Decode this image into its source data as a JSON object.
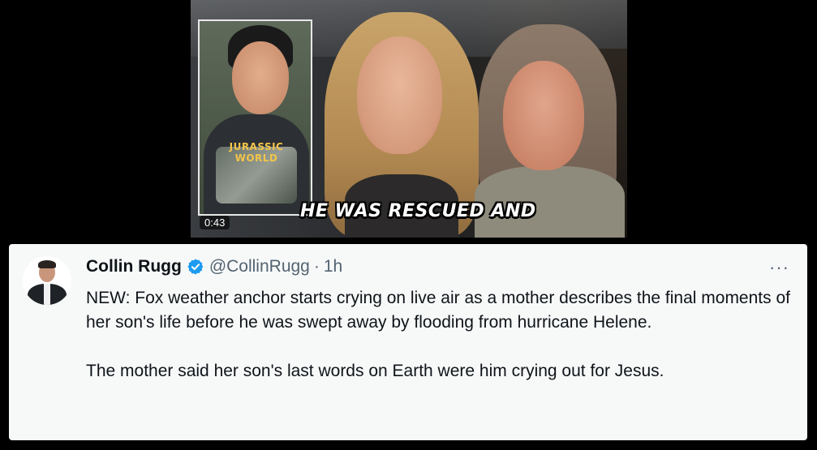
{
  "video": {
    "caption": "HE WAS RESCUED AND",
    "timestamp": "0:43",
    "inset_shirt_text": "JURASSIC WORLD"
  },
  "tweet": {
    "author_name": "Collin Rugg",
    "handle": "@CollinRugg",
    "separator": "·",
    "time": "1h",
    "more_label": "···",
    "paragraphs": [
      "NEW: Fox weather anchor starts crying on live air as a mother describes the final moments of her son's life before he was swept away by flooding from hurricane Helene.",
      "The mother said her son's last words on Earth were him crying out for Jesus."
    ],
    "icons": {
      "verified": "verified-badge-icon",
      "more": "more-options-icon"
    },
    "colors": {
      "verified": "#1d9bf0",
      "text": "#0f1419",
      "muted": "#536471",
      "card_bg": "#f7f9f9"
    }
  }
}
